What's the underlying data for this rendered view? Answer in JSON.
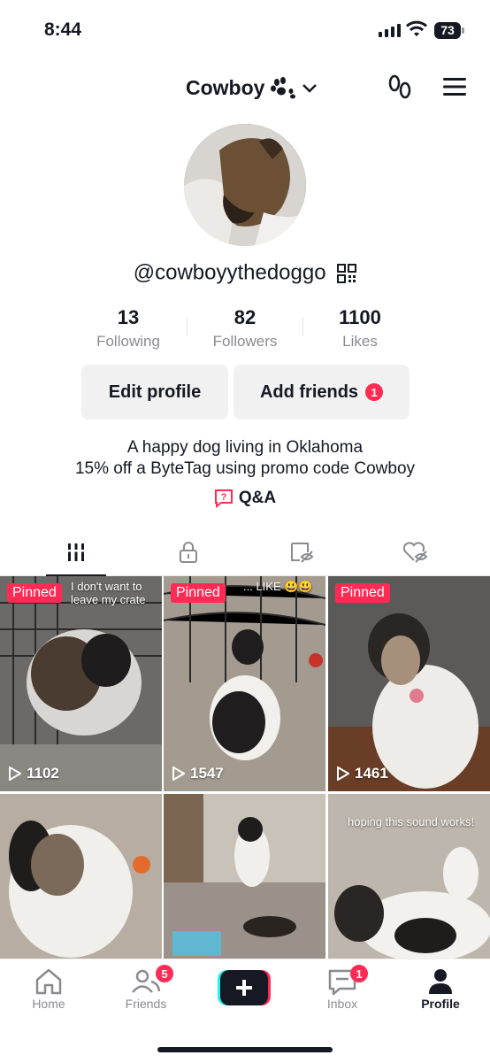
{
  "status_bar": {
    "time": "8:44",
    "battery": "73"
  },
  "header": {
    "username": "Cowboy"
  },
  "profile": {
    "handle": "@cowboyythedoggo",
    "stats": [
      {
        "value": "13",
        "label": "Following"
      },
      {
        "value": "82",
        "label": "Followers"
      },
      {
        "value": "1100",
        "label": "Likes"
      }
    ],
    "edit_button": "Edit profile",
    "add_friends_button": "Add friends",
    "add_friends_badge": "1",
    "bio_line1": "A happy dog living in Oklahoma",
    "bio_line2": "15% off a ByteTag using promo code Cowboy",
    "qa_label": "Q&A"
  },
  "videos": [
    {
      "pinned": "Pinned",
      "views": "1102",
      "caption": "I don't want to leave my crate"
    },
    {
      "pinned": "Pinned",
      "views": "1547",
      "caption": "... LIKE 😃😃"
    },
    {
      "pinned": "Pinned",
      "views": "1461",
      "caption": ""
    },
    {
      "pinned": "",
      "views": "",
      "caption": ""
    },
    {
      "pinned": "",
      "views": "",
      "caption": ""
    },
    {
      "pinned": "",
      "views": "",
      "caption": "hoping this sound works!"
    }
  ],
  "nav": {
    "home": "Home",
    "friends": "Friends",
    "friends_badge": "5",
    "inbox": "Inbox",
    "inbox_badge": "1",
    "profile": "Profile"
  },
  "colors": {
    "accent": "#fe2c55",
    "text": "#161823",
    "muted": "#8a8b91"
  }
}
